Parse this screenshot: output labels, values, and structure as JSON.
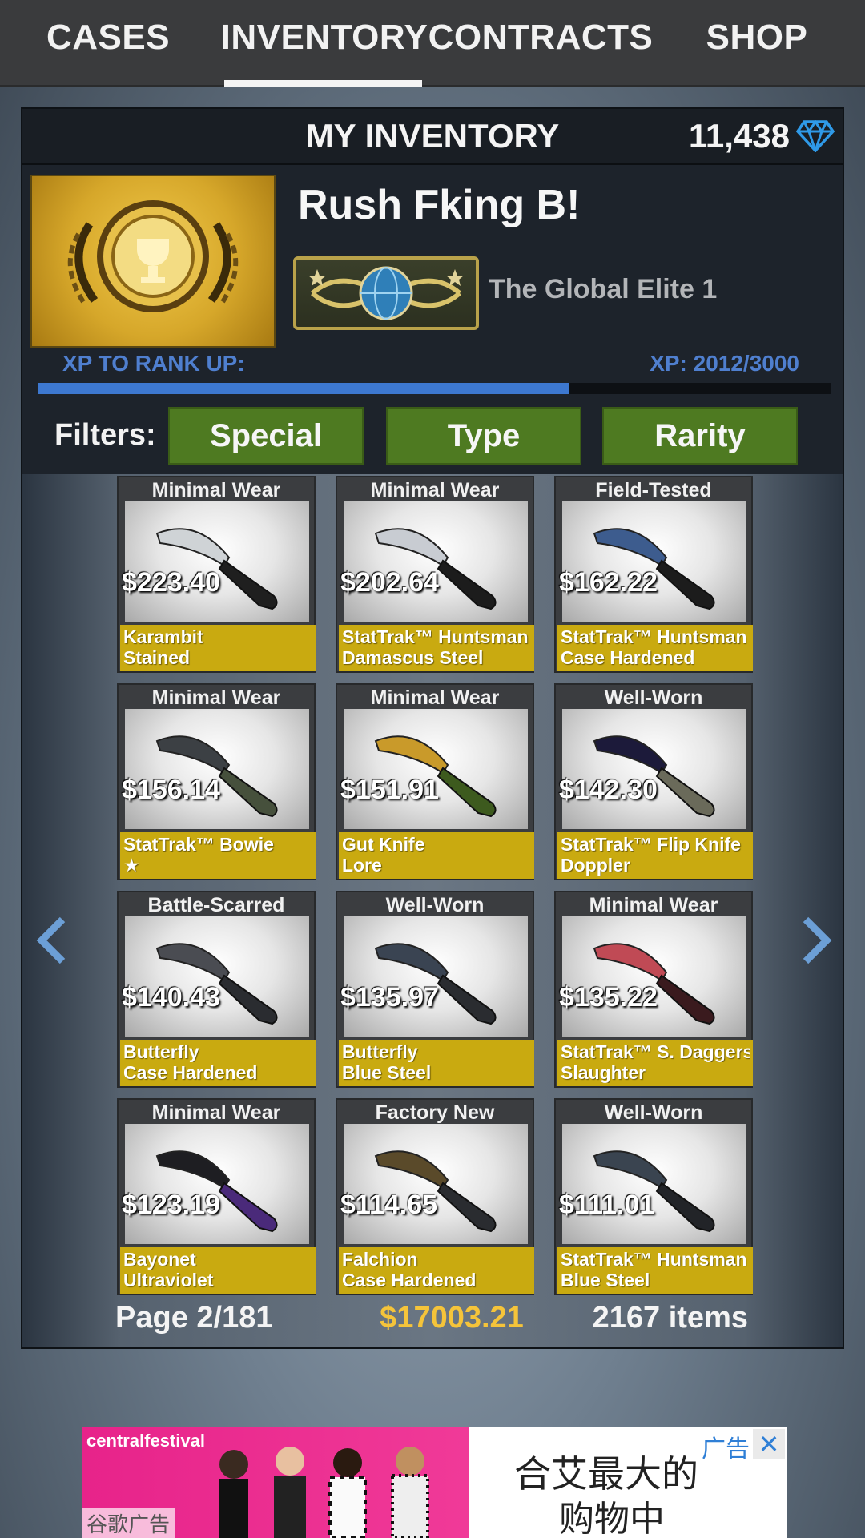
{
  "tabs": [
    {
      "label": "CASES"
    },
    {
      "label": "INVENTORY",
      "active": true
    },
    {
      "label": "CONTRACTS"
    },
    {
      "label": "SHOP"
    }
  ],
  "panel": {
    "title": "MY INVENTORY",
    "currency": "11,438",
    "currency_icon": "diamond-icon"
  },
  "profile": {
    "name": "Rush Fking B!",
    "rank": "The Global Elite 1",
    "xp_label": "XP TO RANK UP:",
    "xp_text": "XP: 2012/3000",
    "xp_fraction": 0.67
  },
  "filters": {
    "label": "Filters:",
    "buttons": [
      "Special",
      "Type",
      "Rarity"
    ]
  },
  "items": [
    {
      "condition": "Minimal Wear",
      "price": "$223.40",
      "line1": "Karambit",
      "line2": "Stained",
      "blade": "#cfd3d6",
      "handle": "#1f1f1f"
    },
    {
      "condition": "Minimal Wear",
      "price": "$202.64",
      "line1": "StatTrak™ Huntsman",
      "line2": "Damascus Steel",
      "blade": "#c8ccd2",
      "handle": "#1c1c1c"
    },
    {
      "condition": "Field-Tested",
      "price": "$162.22",
      "line1": "StatTrak™ Huntsman",
      "line2": "Case Hardened",
      "blade": "#3d5c8e",
      "handle": "#1c1c1c"
    },
    {
      "condition": "Minimal Wear",
      "price": "$156.14",
      "line1": "StatTrak™ Bowie",
      "line2": "★",
      "blade": "#3c4044",
      "handle": "#46503c"
    },
    {
      "condition": "Minimal Wear",
      "price": "$151.91",
      "line1": "Gut Knife",
      "line2": "Lore",
      "blade": "#c99a2a",
      "handle": "#3d5a1e"
    },
    {
      "condition": "Well-Worn",
      "price": "$142.30",
      "line1": "StatTrak™ Flip Knife",
      "line2": "Doppler",
      "blade": "#1c1a3a",
      "handle": "#6a6a5a"
    },
    {
      "condition": "Battle-Scarred",
      "price": "$140.43",
      "line1": "Butterfly",
      "line2": "Case Hardened",
      "blade": "#4a4c52",
      "handle": "#2a2c30"
    },
    {
      "condition": "Well-Worn",
      "price": "$135.97",
      "line1": "Butterfly",
      "line2": "Blue Steel",
      "blade": "#3a4452",
      "handle": "#2a2c30"
    },
    {
      "condition": "Minimal Wear",
      "price": "$135.22",
      "line1": "StatTrak™ S. Daggers",
      "line2": "Slaughter",
      "blade": "#c04a55",
      "handle": "#3a1a1e"
    },
    {
      "condition": "Minimal Wear",
      "price": "$123.19",
      "line1": "Bayonet",
      "line2": "Ultraviolet",
      "blade": "#1e1e22",
      "handle": "#4a2a7a"
    },
    {
      "condition": "Factory New",
      "price": "$114.65",
      "line1": "Falchion",
      "line2": "Case Hardened",
      "blade": "#5a4a2a",
      "handle": "#2a2c30"
    },
    {
      "condition": "Well-Worn",
      "price": "$111.01",
      "line1": "StatTrak™ Huntsman",
      "line2": "Blue Steel",
      "blade": "#3a4450",
      "handle": "#222428"
    }
  ],
  "footer": {
    "page": "Page 2/181",
    "total": "$17003.21",
    "count": "2167 items"
  },
  "ad": {
    "brand": "centralfestival",
    "line1": "合艾最大的",
    "line2": "购物中",
    "tag": "广告",
    "close": "✕",
    "footer": "谷歌广告"
  },
  "colors": {
    "tabbar": "#3a3b3d",
    "panel": "#1d232b",
    "filter": "#4e7a21",
    "item_label": "#c9aa10",
    "xp": "#3d78d0",
    "total": "#f5c43a"
  }
}
